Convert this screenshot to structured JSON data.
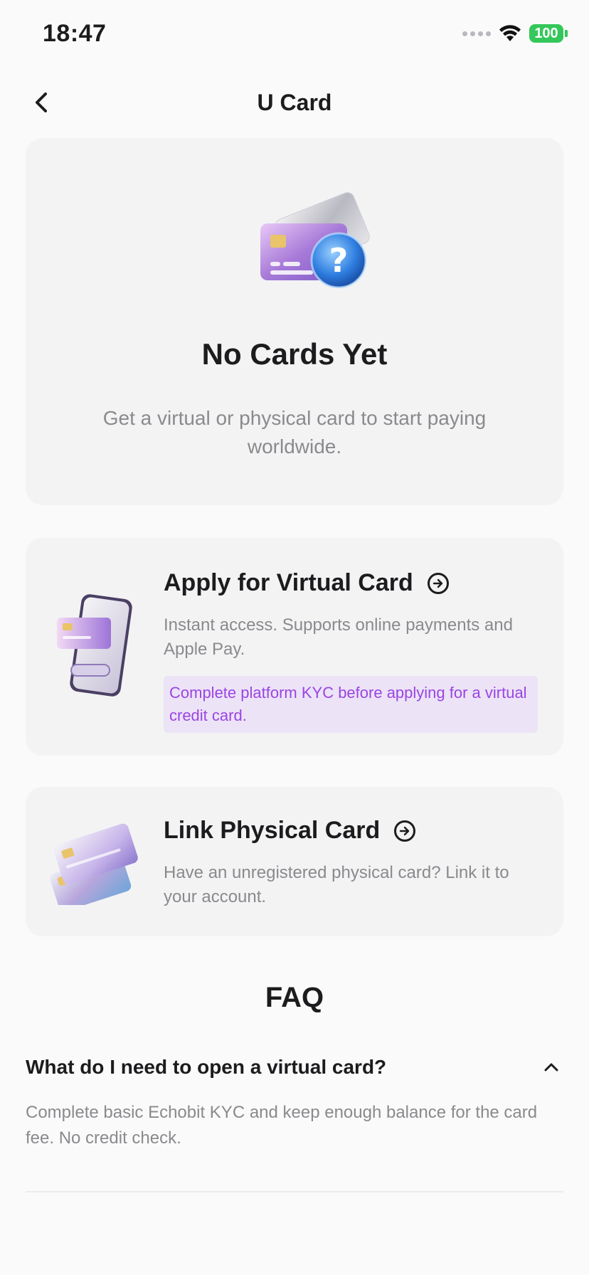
{
  "status_bar": {
    "time": "18:47",
    "battery": "100"
  },
  "nav": {
    "title": "U Card",
    "back_icon": "chevron-left-icon"
  },
  "empty_state": {
    "title": "No Cards Yet",
    "subtitle": "Get a virtual or physical card to start paying worldwide."
  },
  "options": {
    "virtual": {
      "title": "Apply for Virtual Card",
      "description": "Instant access. Supports online payments and Apple Pay.",
      "note": "Complete platform KYC before applying for a virtual credit card."
    },
    "physical": {
      "title": "Link Physical Card",
      "description": "Have an unregistered physical card? Link it to your account."
    }
  },
  "faq": {
    "title": "FAQ",
    "items": [
      {
        "question": "What do I need to open a virtual card?",
        "answer": "Complete basic Echobit KYC and keep enough balance for the card fee. No credit check.",
        "expanded": true
      }
    ]
  },
  "colors": {
    "accent": "#9a45e3",
    "note_bg": "#ece3f7",
    "battery": "#34c759",
    "card_bg": "#f3f3f4"
  }
}
